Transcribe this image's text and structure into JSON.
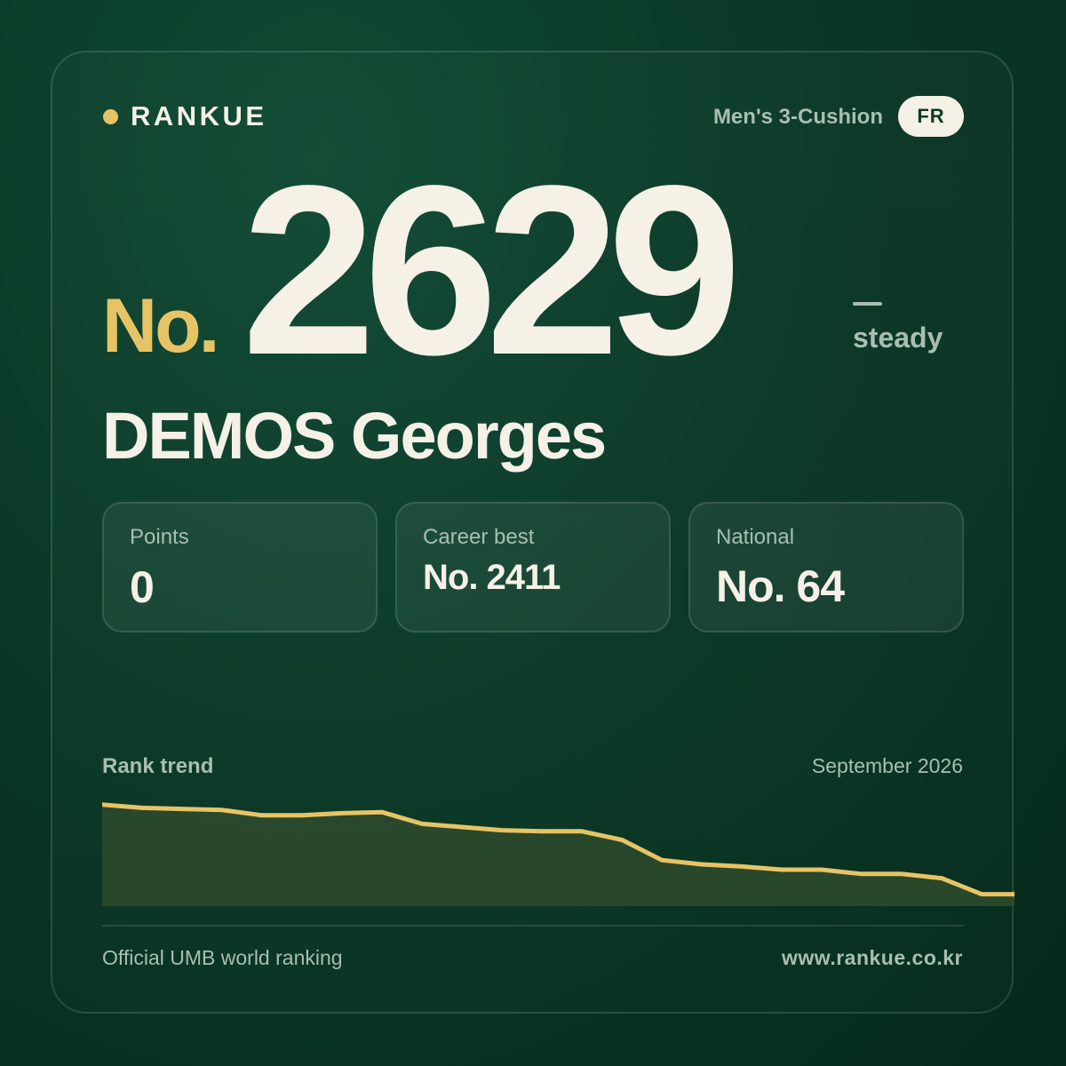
{
  "brand": {
    "name": "RANKUE",
    "dot_color": "#e6c465"
  },
  "header": {
    "discipline": "Men's 3-Cushion",
    "country_code": "FR"
  },
  "rank": {
    "prefix": "No.",
    "number": "2629",
    "change_label": "steady"
  },
  "player": {
    "name": "DEMOS Georges"
  },
  "stats": [
    {
      "label": "Points",
      "value": "0"
    },
    {
      "label": "Career best",
      "value": "No. 2411"
    },
    {
      "label": "National",
      "value": "No. 64"
    }
  ],
  "trend": {
    "title": "Rank trend",
    "date": "September 2026"
  },
  "chart_data": {
    "type": "area",
    "values": [
      0.09,
      0.12,
      0.13,
      0.14,
      0.19,
      0.19,
      0.17,
      0.16,
      0.27,
      0.3,
      0.33,
      0.34,
      0.34,
      0.42,
      0.61,
      0.65,
      0.67,
      0.7,
      0.7,
      0.74,
      0.74,
      0.78,
      0.93,
      0.93
    ],
    "line_color": "#e6c465",
    "fill_color": "#2c4a2c"
  },
  "footer": {
    "source": "Official UMB world ranking",
    "website": "www.rankue.co.kr"
  }
}
